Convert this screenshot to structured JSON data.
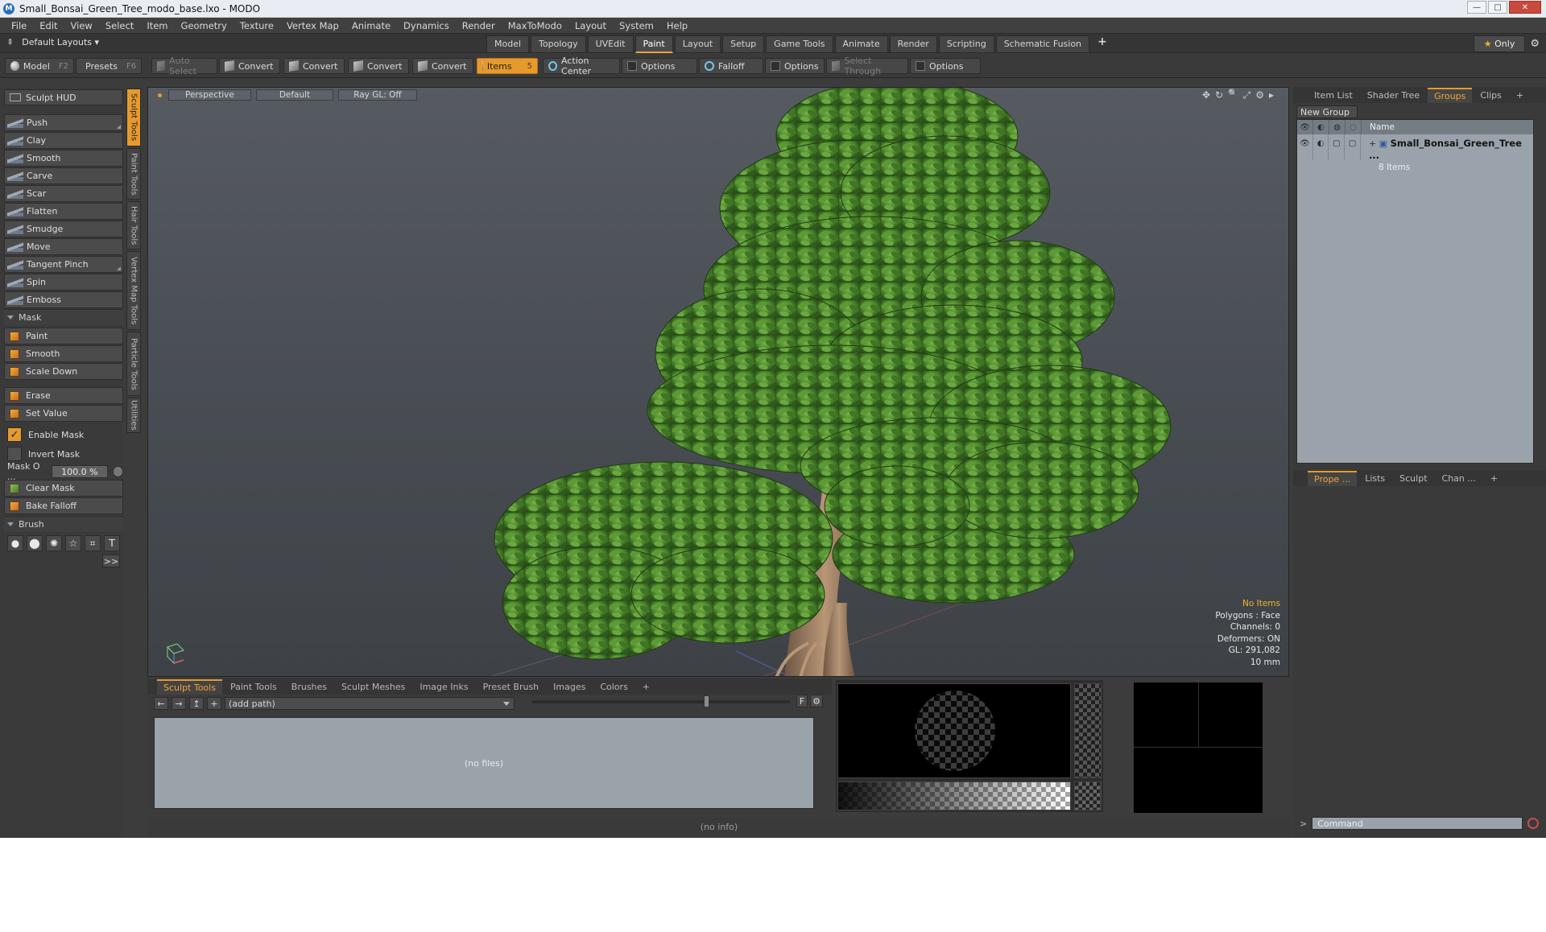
{
  "window": {
    "title": "Small_Bonsai_Green_Tree_modo_base.lxo - MODO",
    "app_icon": "modo-icon",
    "buttons": [
      "—",
      "□",
      "✕"
    ]
  },
  "menubar": [
    "File",
    "Edit",
    "View",
    "Select",
    "Item",
    "Geometry",
    "Texture",
    "Vertex Map",
    "Animate",
    "Dynamics",
    "Render",
    "MaxToModo",
    "Layout",
    "System",
    "Help"
  ],
  "layoutbar": {
    "layouts_label": "Default Layouts ▾",
    "tabs": [
      "Model",
      "Topology",
      "UVEdit",
      "Paint",
      "Layout",
      "Setup",
      "Game Tools",
      "Animate",
      "Render",
      "Scripting",
      "Schematic Fusion"
    ],
    "active_tab": "Paint",
    "plus": "+",
    "only_label": "Only",
    "only_star": "★",
    "gear": "⚙"
  },
  "toolrow": {
    "model": "Model",
    "model_key": "F2",
    "presets": "Presets",
    "presets_key": "F6",
    "auto_select": "Auto Select",
    "convert_labels": [
      "Convert",
      "Convert",
      "Convert",
      "Convert"
    ],
    "items": "Items",
    "items_key": "5",
    "action_center": "Action Center",
    "options_labels": [
      "Options",
      "Options",
      "Options"
    ],
    "falloff": "Falloff",
    "select_through": "Select Through"
  },
  "leftpanel": {
    "hud": "Sculpt HUD",
    "sculpt_tools": [
      "Push",
      "Clay",
      "Smooth",
      "Carve",
      "Scar",
      "Flatten",
      "Smudge",
      "Move",
      "Tangent Pinch",
      "Spin",
      "Emboss"
    ],
    "mask_header": "Mask",
    "mask_tools": [
      "Paint",
      "Smooth",
      "Scale Down"
    ],
    "mask_tools2": [
      "Erase",
      "Set Value"
    ],
    "enable_mask": "Enable Mask",
    "invert_mask": "Invert Mask",
    "mask_opacity_label": "Mask O ...",
    "mask_opacity_value": "100.0 %",
    "mask_actions": [
      "Clear Mask",
      "Bake Falloff"
    ],
    "brush_header": "Brush",
    "brush_icons": [
      "●",
      "⬤",
      "✺",
      "☆",
      "⌗",
      "T"
    ],
    "more": ">>"
  },
  "vtabs": [
    "Sculpt Tools",
    "Paint Tools",
    "Hair Tools",
    "Vertex Map Tools",
    "Particle Tools",
    "Utilities"
  ],
  "viewport": {
    "tabs": [
      "Perspective",
      "Default",
      "Ray GL: Off"
    ],
    "icons": [
      "✥",
      "↻",
      "🔍",
      "⤢",
      "⚙",
      "▸"
    ],
    "info": {
      "no_items": "No Items",
      "polygons": "Polygons : Face",
      "channels": "Channels: 0",
      "deformers": "Deformers: ON",
      "gl": "GL: 291,082",
      "units": "10 mm"
    }
  },
  "browser": {
    "tabs": [
      "Sculpt Tools",
      "Paint Tools",
      "Brushes",
      "Sculpt Meshes",
      "Image Inks",
      "Preset Brush",
      "Images",
      "Colors",
      "+"
    ],
    "active_tab": "Sculpt Tools",
    "nav": [
      "←",
      "→",
      "↥",
      "+"
    ],
    "path": "(add path)",
    "f_button": "F",
    "empty": "(no files)"
  },
  "status": "(no info)",
  "rightpanel": {
    "tabs": [
      "Item List",
      "Shader Tree",
      "Groups",
      "Clips",
      "+"
    ],
    "active_tab": "Groups",
    "new_group": "New Group",
    "col_name": "Name",
    "group_name": "Small_Bonsai_Green_Tree ...",
    "group_count": "8 Items",
    "tabs2": [
      "Prope ...",
      "Lists",
      "Sculpt",
      "Chan ...",
      "+"
    ],
    "active_tab2": "Prope ...",
    "command_placeholder": "Command",
    "prompt": ">"
  },
  "colors": {
    "accent": "#e69a2e",
    "foliage_dark": "#2f5a1c",
    "foliage_mid": "#4d8a2c",
    "foliage_light": "#78b04a",
    "trunk": "#9a7a5c"
  }
}
